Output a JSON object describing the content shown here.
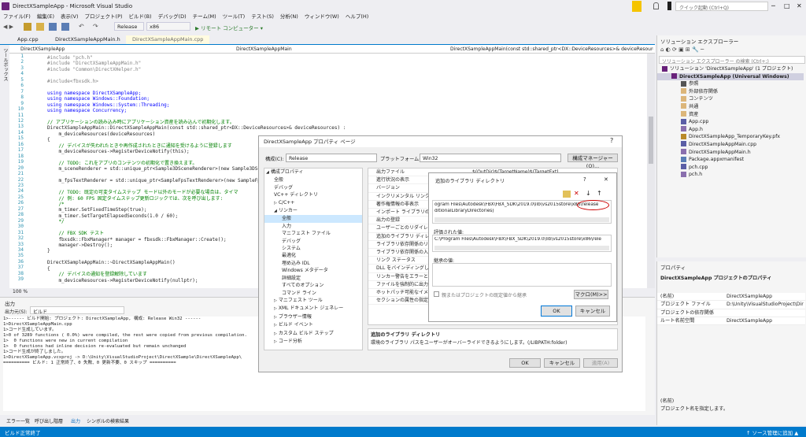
{
  "window": {
    "title": "DirectXSampleApp - Microsoft Visual Studio",
    "quick_launch": "クイック起動 (Ctrl+Q)"
  },
  "menu": [
    "ファイル(F)",
    "編集(E)",
    "表示(V)",
    "プロジェクト(P)",
    "ビルド(B)",
    "デバッグ(D)",
    "チーム(M)",
    "ツール(T)",
    "テスト(S)",
    "分析(N)",
    "ウィンドウ(W)",
    "ヘルプ(H)"
  ],
  "toolbar": {
    "config": "Release",
    "platform": "x86",
    "run": "▶ リモート コンピューター ▾"
  },
  "doc_tabs": [
    "App.cpp",
    "DirectXSampleAppMain.h",
    "DirectXSampleAppMain.cpp"
  ],
  "side_tab": "ツールボックス",
  "nav": {
    "project": "DirectXSampleApp",
    "scope": "DirectXSampleAppMain",
    "member": "DirectXSampleAppMain(const std::shared_ptr<DX::DeviceResources>& deviceResources)"
  },
  "code_lines": [
    {
      "n": "1",
      "t": "#include \"pch.h\""
    },
    {
      "n": "2",
      "t": "#include \"DirectXSampleAppMain.h\""
    },
    {
      "n": "3",
      "t": "#include \"Common\\DirectXHelper.h\""
    },
    {
      "n": "4",
      "t": ""
    },
    {
      "n": "5",
      "t": "#include<fbxsdk.h>"
    },
    {
      "n": "6",
      "t": ""
    },
    {
      "n": "7",
      "t": "using namespace DirectXSampleApp;"
    },
    {
      "n": "8",
      "t": "using namespace Windows::Foundation;"
    },
    {
      "n": "9",
      "t": "using namespace Windows::System::Threading;"
    },
    {
      "n": "10",
      "t": "using namespace Concurrency;"
    },
    {
      "n": "11",
      "t": ""
    },
    {
      "n": "12",
      "t": "// アプリケーションの読み込み時にアプリケーション資産を読み込んで初期化します。"
    },
    {
      "n": "13",
      "t": "DirectXSampleAppMain::DirectXSampleAppMain(const std::shared_ptr<DX::DeviceResources>& deviceResources) :"
    },
    {
      "n": "14",
      "t": "    m_deviceResources(deviceResources)"
    },
    {
      "n": "15",
      "t": "{"
    },
    {
      "n": "16",
      "t": "    // デバイスが失われたときや再作成されたときに通知を受けるように登録します"
    },
    {
      "n": "17",
      "t": "    m_deviceResources->RegisterDeviceNotify(this);"
    },
    {
      "n": "18",
      "t": ""
    },
    {
      "n": "19",
      "t": "    // TODO: これをアプリのコンテンツの初期化で置き換えます。"
    },
    {
      "n": "20",
      "t": "    m_sceneRenderer = std::unique_ptr<Sample3DSceneRenderer>(new Sample3DScene"
    },
    {
      "n": "21",
      "t": ""
    },
    {
      "n": "22",
      "t": "    m_fpsTextRenderer = std::unique_ptr<SampleFpsTextRenderer>(new SampleFpsTe"
    },
    {
      "n": "23",
      "t": ""
    },
    {
      "n": "24",
      "t": "    // TODO: 既定の可変タイムステップ モード以外のモードが必要な場合は、タイマ"
    },
    {
      "n": "25",
      "t": "    // 例: 60 FPS 固定タイムステップ更新ロジックでは、次を呼び出します:"
    },
    {
      "n": "26",
      "t": "    /*"
    },
    {
      "n": "27",
      "t": "    m_timer.SetFixedTimeStep(true);"
    },
    {
      "n": "28",
      "t": "    m_timer.SetTargetElapsedSeconds(1.0 / 60);"
    },
    {
      "n": "29",
      "t": "    */"
    },
    {
      "n": "30",
      "t": ""
    },
    {
      "n": "31",
      "t": "    // FBX SDK テスト"
    },
    {
      "n": "32",
      "t": "    fbxsdk::FbxManager* manager = fbxsdk::FbxManager::Create();"
    },
    {
      "n": "33",
      "t": "    manager->Destroy();"
    },
    {
      "n": "34",
      "t": "}"
    },
    {
      "n": "35",
      "t": ""
    },
    {
      "n": "36",
      "t": "DirectXSampleAppMain::~DirectXSampleAppMain()"
    },
    {
      "n": "37",
      "t": "{"
    },
    {
      "n": "38",
      "t": "    // デバイスの通知を登録解除しています"
    },
    {
      "n": "39",
      "t": "    m_deviceResources->RegisterDeviceNotify(nullptr);"
    }
  ],
  "zoom": "100 %",
  "output": {
    "title": "出力",
    "source_label": "出力元(S):",
    "source_value": "ビルド",
    "lines": [
      "1>------ ビルド開始: プロジェクト: DirectXSampleApp, 構成: Release Win32 ------",
      "1>DirectXSampleAppMain.cpp",
      "1>コード生成しています。",
      "1>0 of 3289 functions ( 0.0%) were compiled, the rest were copied from previous compilation.",
      "1>  0 functions were new in current compilation",
      "1>  0 functions had inline decision re-evaluated but remain unchanged",
      "1>コード生成が終了しました。",
      "1>DirectXSampleApp.vcxproj -> D:\\Unity\\VisualStudioProject\\DirectXSample\\DirectXSampleApp\\",
      "========== ビルド: 1 正常終了、0 失敗、0 更新不要、0 スキップ =========="
    ]
  },
  "bottom_tabs": [
    "エラー一覧",
    "呼び出し階層",
    "出力",
    "シンボルの検索結果"
  ],
  "status": {
    "left": "ビルド正常終了",
    "right": "↑ ソース管理に追加 ▲"
  },
  "solution": {
    "title": "ソリューション エクスプローラー",
    "search": "ソリューション エクスプローラー の検索 (Ctrl+;)",
    "items": [
      {
        "label": "ソリューション 'DirectXSampleApp' (1 プロジェクト)",
        "indent": 0,
        "icon": "solution-icon"
      },
      {
        "label": "DirectXSampleApp (Universal Windows)",
        "indent": 1,
        "bold": true,
        "icon": "project-icon"
      },
      {
        "label": "参照",
        "indent": 2,
        "icon": "references-icon"
      },
      {
        "label": "外部依存関係",
        "indent": 2,
        "icon": "folder-icon"
      },
      {
        "label": "コンテンツ",
        "indent": 2,
        "icon": "folder-icon"
      },
      {
        "label": "共通",
        "indent": 2,
        "icon": "folder-icon"
      },
      {
        "label": "資産",
        "indent": 2,
        "icon": "folder-icon"
      },
      {
        "label": "App.cpp",
        "indent": 2,
        "icon": "cpp-file-icon"
      },
      {
        "label": "App.h",
        "indent": 2,
        "icon": "header-file-icon"
      },
      {
        "label": "DirectXSampleApp_TemporaryKey.pfx",
        "indent": 2,
        "icon": "key-file-icon"
      },
      {
        "label": "DirectXSampleAppMain.cpp",
        "indent": 2,
        "icon": "cpp-file-icon"
      },
      {
        "label": "DirectXSampleAppMain.h",
        "indent": 2,
        "icon": "header-file-icon"
      },
      {
        "label": "Package.appxmanifest",
        "indent": 2,
        "icon": "manifest-icon"
      },
      {
        "label": "pch.cpp",
        "indent": 2,
        "icon": "cpp-file-icon"
      },
      {
        "label": "pch.h",
        "indent": 2,
        "icon": "header-file-icon"
      }
    ]
  },
  "properties": {
    "title": "プロパティ",
    "subject": "DirectXSampleApp プロジェクトのプロパティ",
    "rows": [
      {
        "k": "(名前)",
        "v": "DirectXSampleApp"
      },
      {
        "k": "プロジェクト ファイル",
        "v": "D:\\Unity\\VisualStudioProject\\Dir"
      },
      {
        "k": "プロジェクトの依存関係",
        "v": ""
      },
      {
        "k": "ルート名前空間",
        "v": "DirectXSampleApp"
      }
    ],
    "desc_title": "(名前)",
    "desc": "プロジェクト名を指定します。"
  },
  "prop_dialog": {
    "title": "DirectXSampleApp プロパティ ページ",
    "config_label": "構成(C):",
    "config": "Release",
    "platform_label": "プラットフォーム(P):",
    "platform": "Win32",
    "config_mgr": "構成マネージャー(O)...",
    "tree": [
      {
        "l": "構成プロパティ",
        "i": 0,
        "exp": "◢"
      },
      {
        "l": "全般",
        "i": 1
      },
      {
        "l": "デバッグ",
        "i": 1
      },
      {
        "l": "VC++ ディレクトリ",
        "i": 1
      },
      {
        "l": "C/C++",
        "i": 1,
        "exp": "▷"
      },
      {
        "l": "リンカー",
        "i": 1,
        "exp": "◢"
      },
      {
        "l": "全般",
        "i": 2,
        "sel": true
      },
      {
        "l": "入力",
        "i": 2
      },
      {
        "l": "マニフェスト ファイル",
        "i": 2
      },
      {
        "l": "デバッグ",
        "i": 2
      },
      {
        "l": "システム",
        "i": 2
      },
      {
        "l": "最適化",
        "i": 2
      },
      {
        "l": "埋め込み IDL",
        "i": 2
      },
      {
        "l": "Windows メタデータ",
        "i": 2
      },
      {
        "l": "詳細設定",
        "i": 2
      },
      {
        "l": "すべてのオプション",
        "i": 2
      },
      {
        "l": "コマンド ライン",
        "i": 2
      },
      {
        "l": "マニフェスト ツール",
        "i": 1,
        "exp": "▷"
      },
      {
        "l": "XML ドキュメント ジェネレー",
        "i": 1,
        "exp": "▷"
      },
      {
        "l": "ブラウザー情報",
        "i": 1,
        "exp": "▷"
      },
      {
        "l": "ビルド イベント",
        "i": 1,
        "exp": "▷"
      },
      {
        "l": "カスタム ビルド ステップ",
        "i": 1,
        "exp": "▷"
      },
      {
        "l": "コード分析",
        "i": 1,
        "exp": "▷"
      }
    ],
    "grid": [
      {
        "k": "出力ファイル",
        "v": "$(OutDir)$(TargetName)$(TargetExt)"
      },
      {
        "k": "進行状況の表示",
        "v": ""
      },
      {
        "k": "バージョン",
        "v": ""
      },
      {
        "k": "インクリメンタル リンクを有",
        "v": ""
      },
      {
        "k": "著作権情報の非表示",
        "v": ""
      },
      {
        "k": "インポート ライブラリの無",
        "v": ""
      },
      {
        "k": "出力の登録",
        "v": ""
      },
      {
        "k": "ユーザーごとのリダイレクト",
        "v": ""
      },
      {
        "k": "追加のライブラリ ディレクト",
        "v": ""
      },
      {
        "k": "ライブラリ依存関係のリン",
        "v": ""
      },
      {
        "k": "ライブラリ依存関係の入力",
        "v": ""
      },
      {
        "k": "リンク ステータス",
        "v": ""
      },
      {
        "k": "DLL をバインディングしない",
        "v": ""
      },
      {
        "k": "リンカー警告をエラーとして",
        "v": ""
      },
      {
        "k": "ファイルを強制的に出力",
        "v": ""
      },
      {
        "k": "ホットパッチ可能なイメージ",
        "v": ""
      },
      {
        "k": "セクションの属性の指定",
        "v": ""
      }
    ],
    "desc_title": "追加のライブラリ ディレクトリ",
    "desc": "環境のライブラリ パスをユーザーがオーバーライドできるようにします。(/LIBPATH:folder)",
    "ok": "OK",
    "cancel": "キャンセル",
    "apply": "適用(A)"
  },
  "lib_dialog": {
    "title": "追加のライブラリ ディレクトリ",
    "help": "?",
    "close": "✕",
    "line1a": "ogram Files\\Autodesk\\FBX\\FBX_SDK\\2019.0\\lib\\vs2015store\\x86",
    "line1b": "\\release",
    "line2": "ditionalLibraryDirectories)",
    "eval_label": "評価された値:",
    "eval_value": "C:\\Program Files\\Autodesk\\FBX\\FBX_SDK\\2019.0\\lib\\vs2015store\\x86\\rele",
    "inherit_label": "継承の値:",
    "inherit_check": "親またはプロジェクトの既定値から継承",
    "macro": "マクロ(M)>>",
    "ok": "OK",
    "cancel": "キャンセル"
  },
  "colors": {
    "accent": "#007acc",
    "status_bg": "#007acc",
    "highlight": "#cc0000",
    "flag": "#f5c400"
  }
}
